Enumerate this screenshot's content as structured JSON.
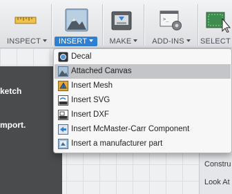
{
  "toolbar": {
    "groups": [
      {
        "label": "INSPECT",
        "icon": "ruler-icon"
      },
      {
        "label": "INSERT",
        "icon": "image-canvas-icon"
      },
      {
        "label": "MAKE",
        "icon": "3d-printer-icon"
      },
      {
        "label": "ADD-INS",
        "icon": "script-gear-icon"
      },
      {
        "label": "SELECT",
        "icon": "select-cursor-icon"
      }
    ]
  },
  "insert_menu": {
    "items": [
      {
        "label": "Decal",
        "icon": "decal-icon"
      },
      {
        "label": "Attached Canvas",
        "icon": "canvas-icon"
      },
      {
        "label": "Insert Mesh",
        "icon": "mesh-icon"
      },
      {
        "label": "Insert SVG",
        "icon": "svg-icon"
      },
      {
        "label": "Insert DXF",
        "icon": "dxf-icon"
      },
      {
        "label": "Insert McMaster-Carr Component",
        "icon": "mcmaster-icon"
      },
      {
        "label": "Insert a manufacturer part",
        "icon": "manufacturer-part-icon"
      }
    ],
    "highlighted_index": 1
  },
  "tooltip_panel": {
    "line1": "ketch",
    "line2": "mport."
  },
  "browser_panel": {
    "items": [
      "Constru",
      "Look At"
    ]
  },
  "colors": {
    "accent": "#2f7fd2",
    "highlight": "#c3c5c8",
    "dark_panel": "#4a4b4d"
  }
}
